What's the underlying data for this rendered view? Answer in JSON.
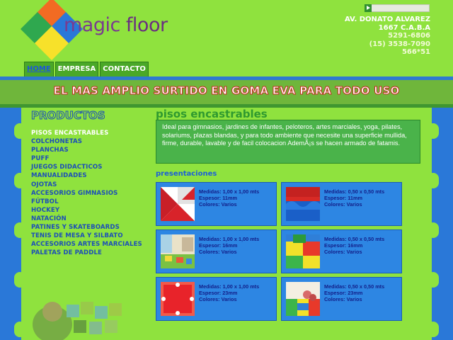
{
  "header": {
    "logo_text_a": "magic ",
    "logo_text_b": "floor",
    "address_line1": "AV. DONATO ALVAREZ",
    "address_line2": "1667 C.A.B.A",
    "phone1": "5291-6806",
    "phone2": "(15) 3538-7090",
    "phone3": "566*51",
    "logo_colors": [
      "#f26b23",
      "#2fa84f",
      "#2a78d8",
      "#f7e12a"
    ]
  },
  "nav": {
    "tabs": [
      {
        "label": "HOME",
        "active": true
      },
      {
        "label": "EMPRESA",
        "active": false
      },
      {
        "label": "CONTACTO",
        "active": false
      }
    ]
  },
  "banner": {
    "slogan": "EL MAS AMPLIO SURTIDO EN GOMA EVA PARA TODO USO"
  },
  "sidebar": {
    "title": "PRODUCTOS",
    "items": [
      {
        "label": "Pisos encastrables",
        "active": true
      },
      {
        "label": "Colchonetas",
        "active": false
      },
      {
        "label": "Planchas",
        "active": false
      },
      {
        "label": "Puff",
        "active": false
      },
      {
        "label": "Juegos didacticos",
        "active": false
      },
      {
        "label": "Manualidades",
        "active": false
      },
      {
        "label": "Ojotas",
        "active": false
      },
      {
        "label": "Accesorios gimnasios",
        "active": false
      },
      {
        "label": "Fútbol",
        "active": false
      },
      {
        "label": "Hockey",
        "active": false
      },
      {
        "label": "Natación",
        "active": false
      },
      {
        "label": "Patines y skateboards",
        "active": false
      },
      {
        "label": "Tenis de mesa y silbato",
        "active": false
      },
      {
        "label": "Accesorios artes marciales",
        "active": false
      },
      {
        "label": "Paletas de paddle",
        "active": false
      }
    ]
  },
  "main": {
    "title": "pisos encastrables",
    "description": "Ideal para gimnasios, jardines de infantes, peloteros, artes marciales, yoga, pilates, solariums, plazas blandas, y para todo ambiente que necesite una superficie mullida, firme, durable, lavable y de facil colocacion AdemÃ¡s se hacen armado de fatamis.",
    "presentations_title": "presentaciones",
    "products": [
      {
        "medidas": "Medidas: 1,00 x 1,00 mts",
        "espesor": "Espesor: 11mm",
        "colores": "Colores: Varios",
        "thumb": "red-white-mat"
      },
      {
        "medidas": "Medidas: 0,50 x 0,50 mts",
        "espesor": "Espesor: 11mm",
        "colores": "Colores: Varios",
        "thumb": "blue-red-puzzle"
      },
      {
        "medidas": "Medidas: 1,00 x 1,00 mts",
        "espesor": "Espesor: 16mm",
        "colores": "Colores: Varios",
        "thumb": "kindergarten-room"
      },
      {
        "medidas": "Medidas: 0,50 x 0,50 mts",
        "espesor": "Espesor: 16mm",
        "colores": "Colores: Varios",
        "thumb": "colorful-floor"
      },
      {
        "medidas": "Medidas: 1,00 x 1,00 mts",
        "espesor": "Espesor: 23mm",
        "colores": "Colores: Varios",
        "thumb": "red-mat"
      },
      {
        "medidas": "Medidas: 0,50 x 0,50 mts",
        "espesor": "Espesor: 23mm",
        "colores": "Colores: Varios",
        "thumb": "kids-play-floor"
      }
    ]
  }
}
